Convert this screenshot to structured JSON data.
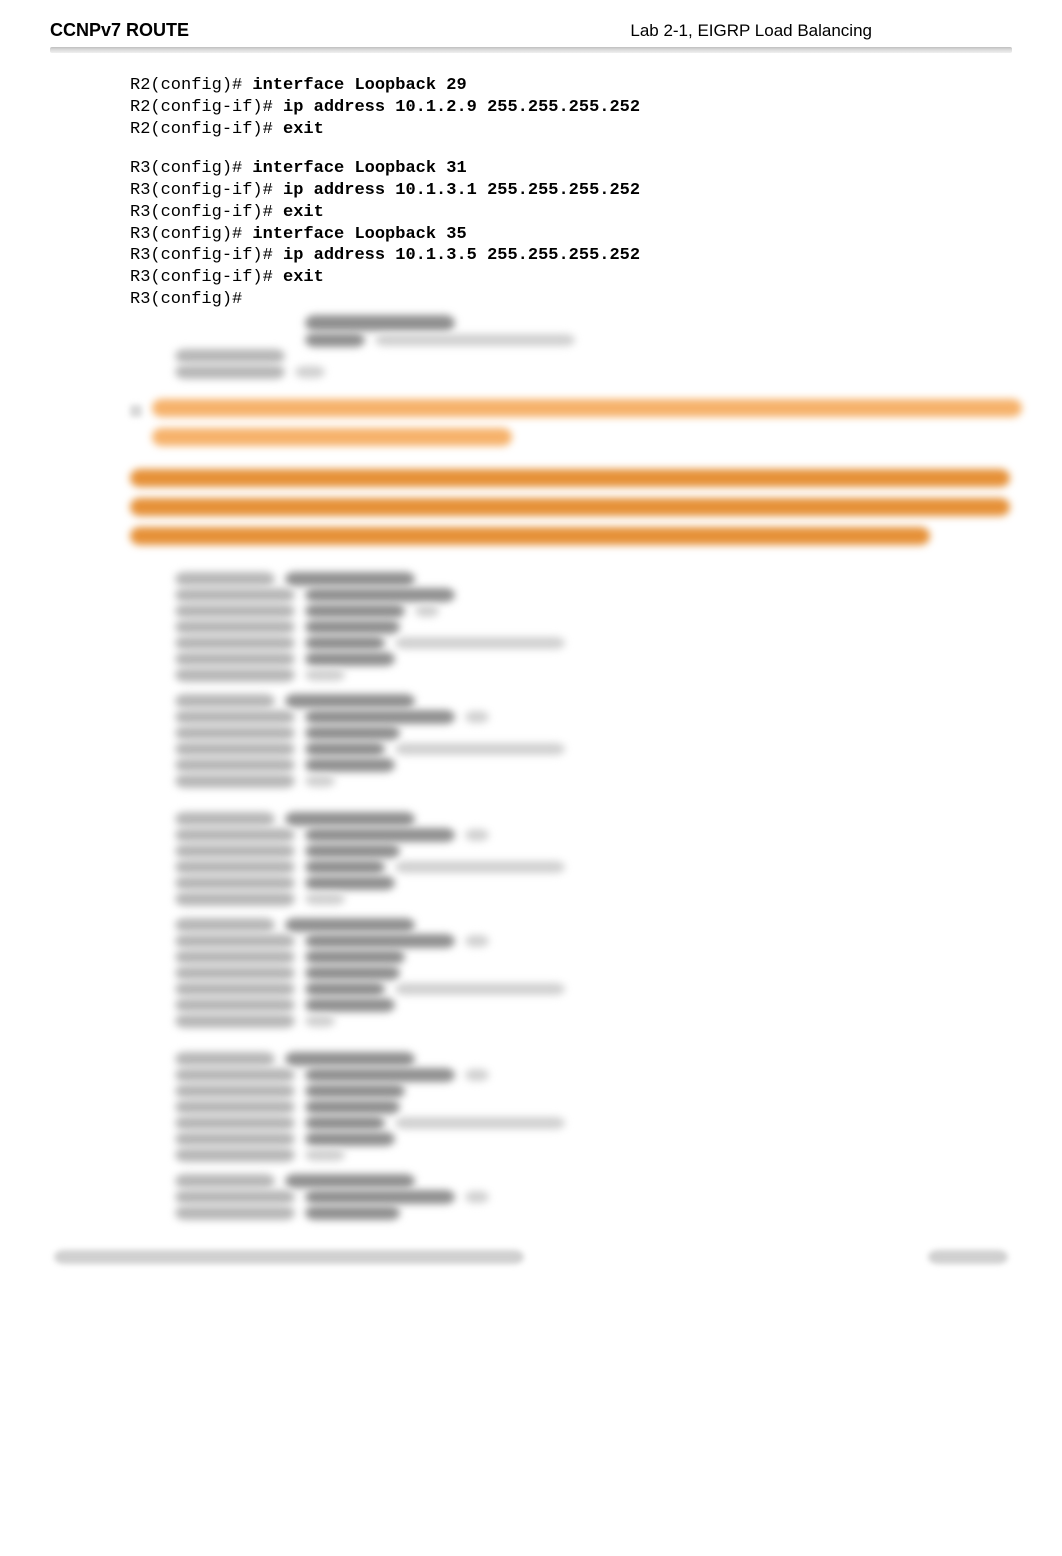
{
  "header": {
    "left": "CCNPv7 ROUTE",
    "right": "Lab 2-1, EIGRP Load Balancing"
  },
  "code_r2": [
    {
      "prompt": "R2(config)# ",
      "cmd": "interface Loopback 29"
    },
    {
      "prompt": "R2(config-if)# ",
      "cmd": "ip address 10.1.2.9 255.255.255.252"
    },
    {
      "prompt": "R2(config-if)# ",
      "cmd": "exit"
    }
  ],
  "code_r3": [
    {
      "prompt": "R3(config)# ",
      "cmd": "interface Loopback 31"
    },
    {
      "prompt": "R3(config-if)# ",
      "cmd": "ip address 10.1.3.1 255.255.255.252"
    },
    {
      "prompt": "R3(config-if)# ",
      "cmd": "exit"
    },
    {
      "prompt": "R3(config)# ",
      "cmd": "interface Loopback 35"
    },
    {
      "prompt": "R3(config-if)# ",
      "cmd": "ip address 10.1.3.5 255.255.255.252"
    },
    {
      "prompt": "R3(config-if)# ",
      "cmd": "exit"
    },
    {
      "prompt": "R3(config)#",
      "cmd": ""
    }
  ]
}
